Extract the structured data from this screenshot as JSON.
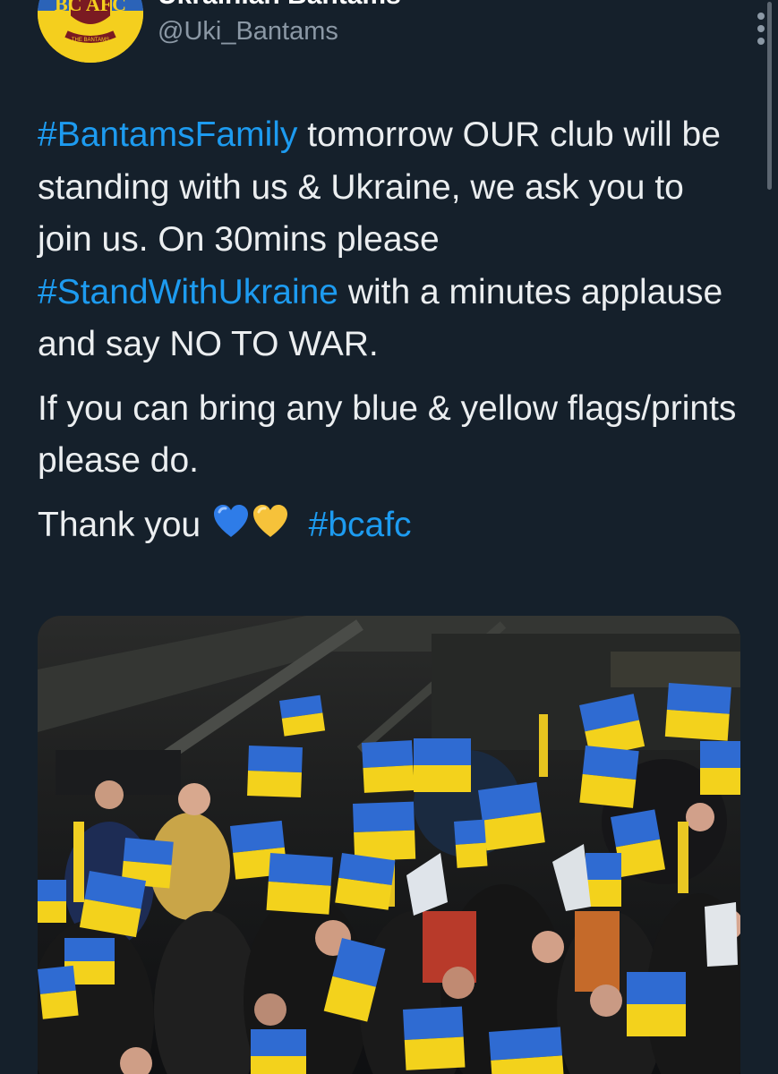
{
  "author": {
    "display_name": "Ukrainian Bantams",
    "handle": "@Uki_Bantams",
    "avatar": {
      "label": "BC AFC",
      "badge_text": "THE BANTAMS",
      "colors": [
        "#2b63b8",
        "#f4cf1e",
        "#7a1a22"
      ]
    }
  },
  "tweet": {
    "paragraph1": [
      {
        "kind": "hashtag",
        "text": "#BantamsFamily"
      },
      {
        "kind": "text",
        "text": " tomorrow OUR club will be standing with us & Ukraine, we ask you to join us. On 30mins please "
      },
      {
        "kind": "hashtag",
        "text": "#StandWithUkraine"
      },
      {
        "kind": "text",
        "text": " with a minutes applause and say NO TO WAR."
      }
    ],
    "paragraph2": "If you can bring any blue & yellow flags/prints please do.",
    "paragraph3": {
      "text": "Thank you ",
      "emojis": [
        "blue-heart",
        "yellow-heart"
      ],
      "hashtag": "#bcafc"
    }
  },
  "media": {
    "description_icon": "crowd-with-ukraine-flags-photo"
  },
  "icons": {
    "more": "more-dots-icon"
  },
  "colors": {
    "background": "#15202b",
    "text": "#ebeef0",
    "secondary_text": "#8b98a5",
    "link": "#1d9bf0",
    "flag_blue": "#1f5fbf",
    "flag_yellow": "#f3d21c"
  }
}
